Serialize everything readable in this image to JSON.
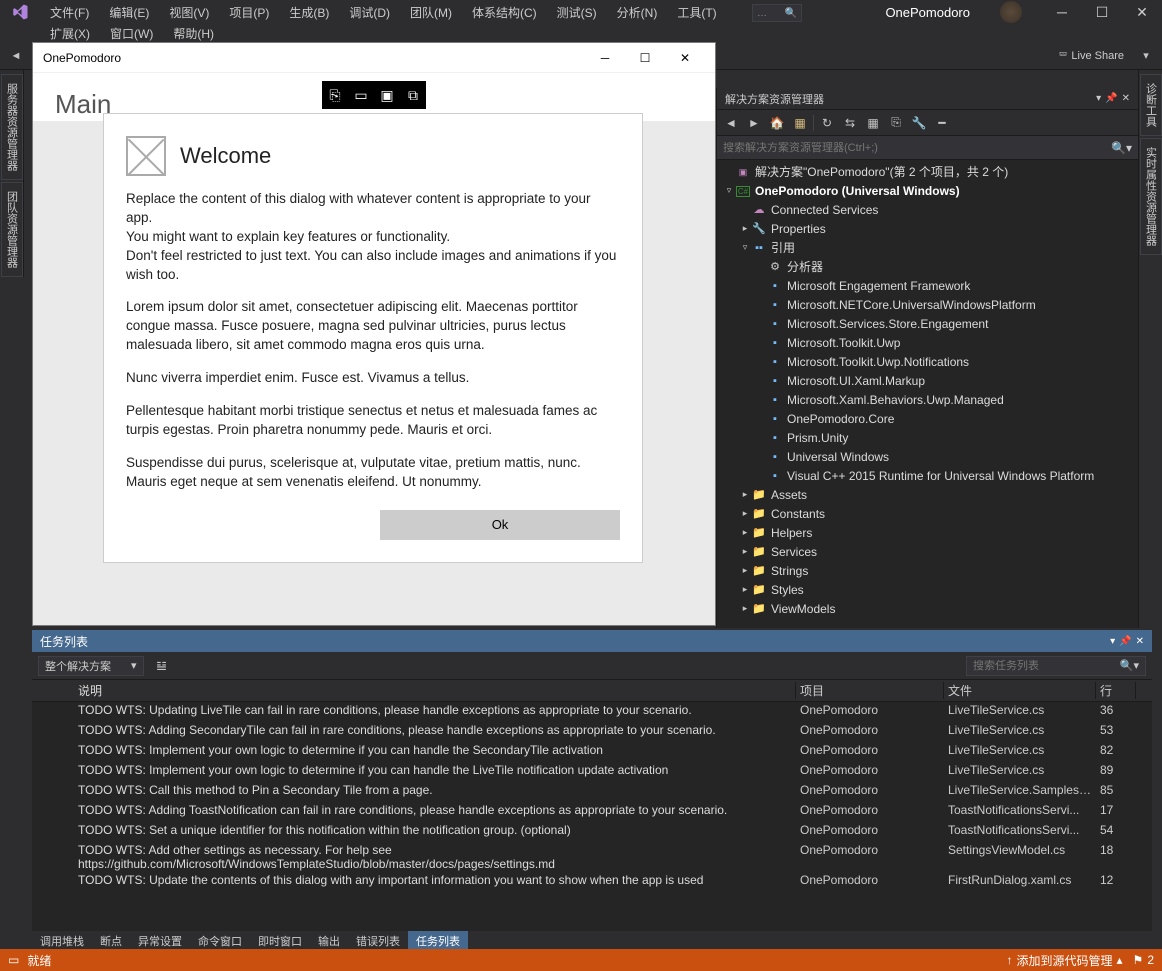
{
  "appTitle": "OnePomodoro",
  "menu": {
    "row1": [
      "文件(F)",
      "编辑(E)",
      "视图(V)",
      "项目(P)",
      "生成(B)",
      "调试(D)",
      "团队(M)",
      "体系结构(C)",
      "测试(S)",
      "分析(N)",
      "工具(T)"
    ],
    "row2": [
      "扩展(X)",
      "窗口(W)",
      "帮助(H)"
    ]
  },
  "liveShare": "Live Share",
  "preview": {
    "title": "OnePomodoro",
    "mainLabel": "Main"
  },
  "dialog": {
    "title": "Welcome",
    "p1": "Replace the content of this dialog with whatever content is appropriate to your app.",
    "p2": "You might want to explain key features or functionality.",
    "p3": "Don't feel restricted to just text. You can also include images and animations if you wish too.",
    "p4": "Lorem ipsum dolor sit amet, consectetuer adipiscing elit. Maecenas porttitor congue massa. Fusce posuere, magna sed pulvinar ultricies, purus lectus malesuada libero, sit amet commodo magna eros quis urna.",
    "p5": "Nunc viverra imperdiet enim. Fusce est. Vivamus a tellus.",
    "p6": "Pellentesque habitant morbi tristique senectus et netus et malesuada fames ac turpis egestas. Proin pharetra nonummy pede. Mauris et orci.",
    "p7": "Suspendisse dui purus, scelerisque at, vulputate vitae, pretium mattis, nunc. Mauris eget neque at sem venenatis eleifend. Ut nonummy.",
    "ok": "Ok"
  },
  "solution": {
    "panelTitle": "解决方案资源管理器",
    "searchPlaceholder": "搜索解决方案资源管理器(Ctrl+;)",
    "root": "解决方案\"OnePomodoro\"(第 2 个项目，共 2 个)",
    "proj": "OnePomodoro (Universal Windows)",
    "connected": "Connected Services",
    "properties": "Properties",
    "references": "引用",
    "analyzer": "分析器",
    "refs": [
      "Microsoft Engagement Framework",
      "Microsoft.NETCore.UniversalWindowsPlatform",
      "Microsoft.Services.Store.Engagement",
      "Microsoft.Toolkit.Uwp",
      "Microsoft.Toolkit.Uwp.Notifications",
      "Microsoft.UI.Xaml.Markup",
      "Microsoft.Xaml.Behaviors.Uwp.Managed",
      "OnePomodoro.Core",
      "Prism.Unity",
      "Universal Windows",
      "Visual C++ 2015 Runtime for Universal Windows Platform"
    ],
    "folders": [
      "Assets",
      "Constants",
      "Helpers",
      "Services",
      "Strings",
      "Styles",
      "ViewModels"
    ]
  },
  "taskList": {
    "title": "任务列表",
    "scope": "整个解决方案",
    "searchPlaceholder": "搜索任务列表",
    "cols": {
      "desc": "说明",
      "proj": "项目",
      "file": "文件",
      "line": "行"
    },
    "rows": [
      {
        "desc": "TODO WTS: Updating LiveTile can fail in rare conditions, please handle exceptions as appropriate to your scenario.",
        "proj": "OnePomodoro",
        "file": "LiveTileService.cs",
        "line": "36"
      },
      {
        "desc": "TODO WTS: Adding SecondaryTile can fail in rare conditions, please handle exceptions as appropriate to your scenario.",
        "proj": "OnePomodoro",
        "file": "LiveTileService.cs",
        "line": "53"
      },
      {
        "desc": "TODO WTS: Implement your own logic to determine if you can handle the SecondaryTile activation",
        "proj": "OnePomodoro",
        "file": "LiveTileService.cs",
        "line": "82"
      },
      {
        "desc": "TODO WTS: Implement your own logic to determine if you can handle the LiveTile notification update activation",
        "proj": "OnePomodoro",
        "file": "LiveTileService.cs",
        "line": "89"
      },
      {
        "desc": "TODO WTS: Call this method to Pin a Secondary Tile from a page.",
        "proj": "OnePomodoro",
        "file": "LiveTileService.Samples....",
        "line": "85"
      },
      {
        "desc": "TODO WTS: Adding ToastNotification can fail in rare conditions, please handle exceptions as appropriate to your scenario.",
        "proj": "OnePomodoro",
        "file": "ToastNotificationsServi...",
        "line": "17"
      },
      {
        "desc": "TODO WTS: Set a unique identifier for this notification within the notification group. (optional)",
        "proj": "OnePomodoro",
        "file": "ToastNotificationsServi...",
        "line": "54"
      },
      {
        "desc": "TODO WTS: Add other settings as necessary. For help see https://github.com/Microsoft/WindowsTemplateStudio/blob/master/docs/pages/settings.md",
        "proj": "OnePomodoro",
        "file": "SettingsViewModel.cs",
        "line": "18"
      },
      {
        "desc": "TODO WTS: Update the contents of this dialog with any important information you want to show when the app is used",
        "proj": "OnePomodoro",
        "file": "FirstRunDialog.xaml.cs",
        "line": "12"
      }
    ]
  },
  "bottomTabs": [
    "调用堆栈",
    "断点",
    "异常设置",
    "命令窗口",
    "即时窗口",
    "输出",
    "错误列表",
    "任务列表"
  ],
  "status": {
    "ready": "就绪",
    "source": "添加到源代码管理",
    "notif": "2"
  },
  "sideTabs": {
    "left": [
      "服务器资源管理器",
      "团队资源管理器"
    ],
    "right": [
      "诊断工具",
      "实时属性资源管理器"
    ]
  }
}
